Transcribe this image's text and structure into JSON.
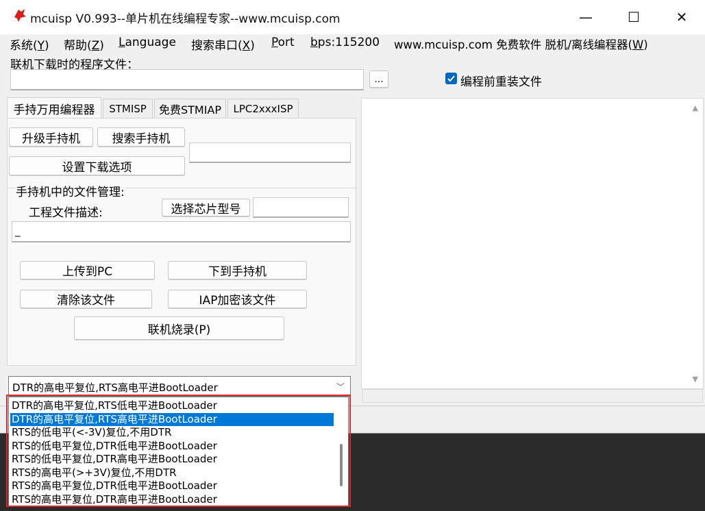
{
  "window": {
    "title": "mcuisp V0.993--单片机在线编程专家--www.mcuisp.com",
    "minimize": "—",
    "maximize": "☐",
    "close": "✕"
  },
  "menu": [
    {
      "label": "系统(",
      "key": "Y",
      "tail": ")"
    },
    {
      "label": "帮助(",
      "key": "Z",
      "tail": ")"
    },
    {
      "label": "",
      "key": "L",
      "tail": "anguage"
    },
    {
      "label": "搜索串口(",
      "key": "X",
      "tail": ")"
    },
    {
      "label": "",
      "key": "P",
      "tail": "ort"
    },
    {
      "label": "",
      "key": "b",
      "tail": "ps:115200"
    },
    {
      "label": "www.mcuisp.com 免费软件 脱机/离线编程器(",
      "key": "W",
      "tail": ")"
    }
  ],
  "program_file": {
    "label": "联机下载时的程序文件：",
    "value": "",
    "browse_label": "...",
    "reload_label": "编程前重装文件",
    "reload_checked": true
  },
  "tabs": [
    "手持万用编程器",
    "STMISP",
    "免费STMIAP",
    "LPC2xxxISP"
  ],
  "handheld": {
    "upgrade_label": "升级手持机",
    "search_label": "搜索手持机",
    "settings_label": "设置下载选项",
    "status_value": "",
    "file_mgmt_label": "手持机中的文件管理:",
    "project_desc_label": "工程文件描述:",
    "choose_chip_label": "选择芯片型号",
    "chip_value": "",
    "desc_value": "_",
    "upload_label": "上传到PC",
    "download_label": "下到手持机",
    "delete_label": "清除该文件",
    "encrypt_label": "IAP加密该文件",
    "online_burn_label": "联机烧录(P)"
  },
  "boot_select": {
    "selected": "DTR的高电平复位,RTS高电平进BootLoader",
    "options": [
      "DTR的高电平复位,RTS低电平进BootLoader",
      "DTR的高电平复位,RTS高电平进BootLoader",
      "RTS的低电平(<-3V)复位,不用DTR",
      "RTS的低电平复位,DTR低电平进BootLoader",
      "RTS的低电平复位,DTR高电平进BootLoader",
      "RTS的高电平(>+3V)复位,不用DTR",
      "RTS的高电平复位,DTR低电平进BootLoader",
      "RTS的高电平复位,DTR高电平进BootLoader"
    ],
    "highlighted_index": 1
  },
  "colors": {
    "selection": "#0078d7",
    "frame": "#e0282e",
    "checkbox": "#0067c0"
  }
}
